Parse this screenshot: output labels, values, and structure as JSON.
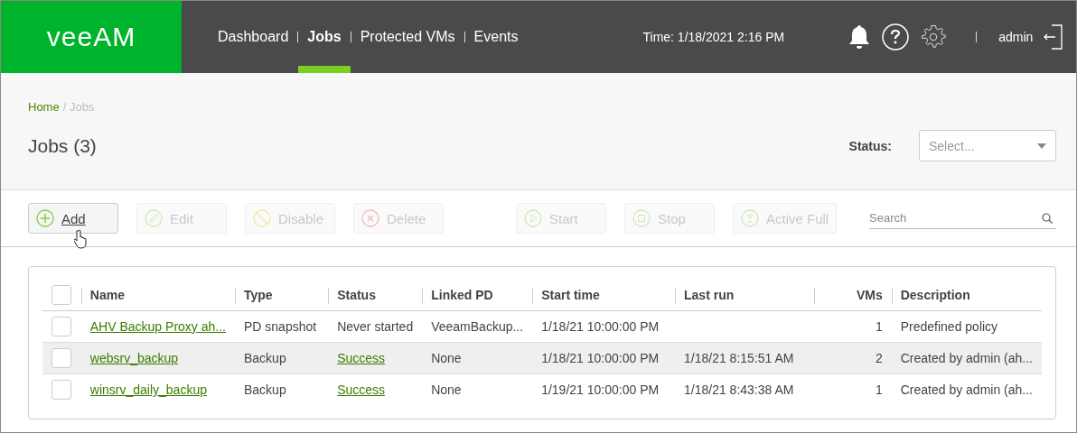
{
  "header": {
    "logo": "veeAM",
    "nav": [
      {
        "label": "Dashboard",
        "selected": false
      },
      {
        "label": "Jobs",
        "selected": true
      },
      {
        "label": "Protected VMs",
        "selected": false
      },
      {
        "label": "Events",
        "selected": false
      }
    ],
    "time": "Time: 1/18/2021 2:16 PM",
    "user": "admin"
  },
  "breadcrumb": {
    "home": "Home",
    "current": "/ Jobs"
  },
  "title": "Jobs (3)",
  "status_filter": {
    "label": "Status:",
    "placeholder": "Select..."
  },
  "toolbar": [
    {
      "label": "Add",
      "kind": "add",
      "disabled": false
    },
    {
      "label": "Edit",
      "kind": "edit",
      "disabled": true
    },
    {
      "label": "Disable",
      "kind": "disable",
      "disabled": true
    },
    {
      "label": "Delete",
      "kind": "delete",
      "disabled": true
    },
    {
      "label": "Start",
      "kind": "start",
      "disabled": true
    },
    {
      "label": "Stop",
      "kind": "stop",
      "disabled": true
    },
    {
      "label": "Active Full",
      "kind": "full",
      "disabled": true
    }
  ],
  "search": {
    "placeholder": "Search"
  },
  "table": {
    "select_all": false,
    "columns": [
      "Name",
      "Type",
      "Status",
      "Linked PD",
      "Start time",
      "Last run",
      "VMs",
      "Description"
    ],
    "rows": [
      {
        "checked": false,
        "hovered": false,
        "name": "AHV Backup Proxy ah...",
        "type": "PD snapshot",
        "status": "Never started",
        "status_link": false,
        "linked_pd": "VeeamBackup...",
        "start_time": "1/18/21 10:00:00 PM",
        "vms": "1",
        "description": "Predefined policy"
      },
      {
        "checked": false,
        "hovered": true,
        "name": "websrv_backup",
        "type": "Backup",
        "status": "Success",
        "status_link": true,
        "linked_pd": "None",
        "start_time": "1/18/21 10:00:00 PM",
        "last_run": "1/18/21 8:15:51 AM",
        "vms": "2",
        "description": "Created by admin (ah..."
      },
      {
        "checked": false,
        "hovered": false,
        "name": "winsrv_daily_backup",
        "type": "Backup",
        "status": "Success",
        "status_link": true,
        "linked_pd": "None",
        "start_time": "1/19/21 10:00:00 PM",
        "last_run": "1/18/21 8:43:38 AM",
        "vms": "1",
        "description": "Created by admin (ah..."
      }
    ]
  }
}
